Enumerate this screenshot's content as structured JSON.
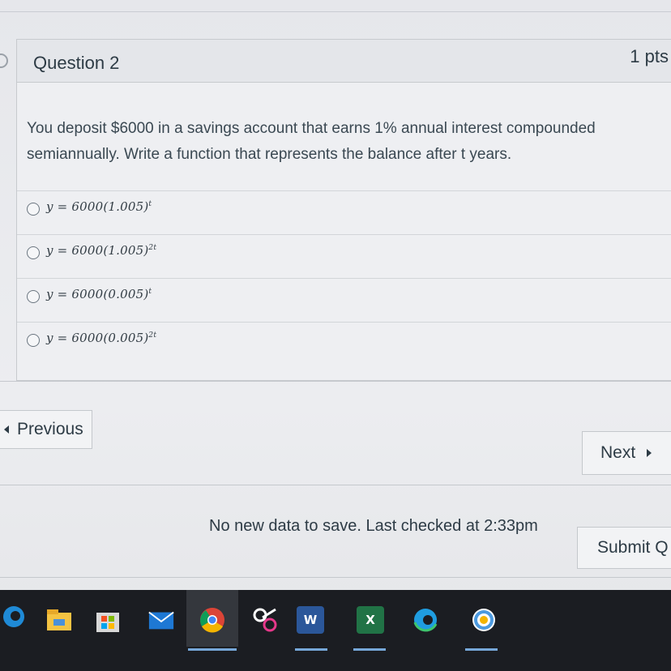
{
  "question": {
    "title": "Question 2",
    "points": "1 pts",
    "text": "You deposit $6000 in a savings account that earns 1% annual interest compounded semiannually. Write a function that represents the balance after t years."
  },
  "answers": [
    {
      "base": "y = 6000(1.005)",
      "exponent": "t"
    },
    {
      "base": "y = 6000(1.005)",
      "exponent": "2t"
    },
    {
      "base": "y = 6000(0.005)",
      "exponent": "t"
    },
    {
      "base": "y = 6000(0.005)",
      "exponent": "2t"
    }
  ],
  "navigation": {
    "previous_label": "Previous",
    "next_label": "Next"
  },
  "footer": {
    "status": "No new data to save. Last checked at 2:33pm",
    "submit_label": "Submit Q"
  },
  "taskbar": {
    "icons": [
      "edge-legacy-icon",
      "file-explorer-icon",
      "microsoft-store-icon",
      "mail-icon",
      "chrome-icon",
      "snip-sketch-icon",
      "word-icon",
      "excel-icon",
      "edge-icon",
      "photos-icon"
    ],
    "word_letter": "W",
    "excel_letter": "X"
  },
  "colors": {
    "text": "#2d3b45",
    "taskbar": "#1b1d22",
    "active_underline": "#76a7d9"
  }
}
